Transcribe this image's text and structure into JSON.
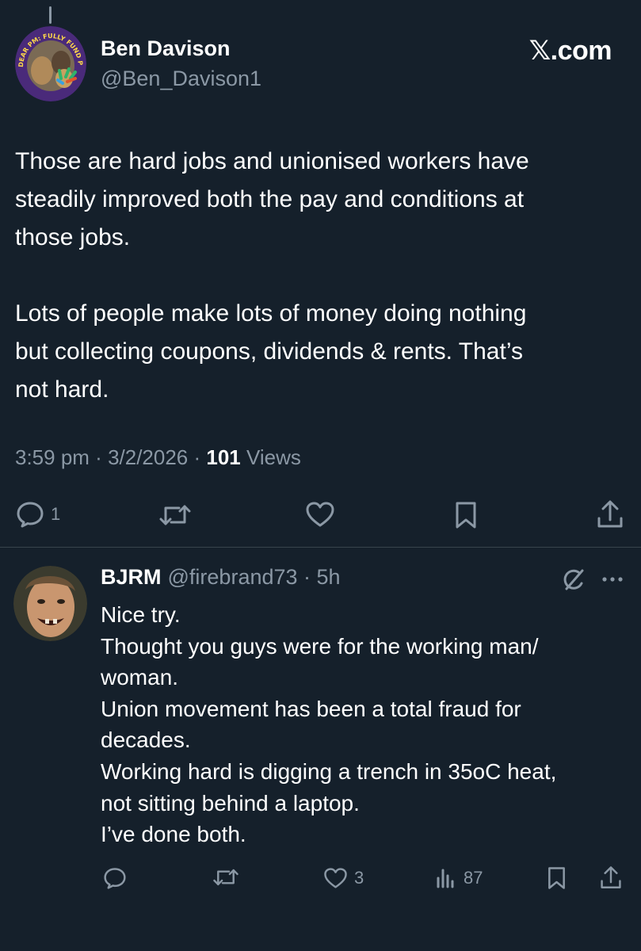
{
  "main_tweet": {
    "author": {
      "name": "Ben Davison",
      "handle": "@Ben_Davison1",
      "avatar_text": "DEAR PM: FULLY FUND PUBLIC SCHOOLS!"
    },
    "site_badge": "𝕏.com",
    "text_paragraphs": [
      "Those are hard jobs and unionised workers have\nsteadily improved both the pay and conditions at\nthose jobs.",
      "Lots of people make lots of money doing nothing\nbut collecting coupons, dividends & rents. That’s\nnot hard."
    ],
    "meta": {
      "time": "3:59 pm",
      "sep1": " · ",
      "date": "3/2/2026",
      "sep2": " · ",
      "views_count": "101",
      "views_label": " Views"
    },
    "actions": {
      "reply_count": "1",
      "icons": [
        "reply-icon",
        "retweet-icon",
        "like-icon",
        "bookmark-icon",
        "share-icon"
      ]
    }
  },
  "reply": {
    "author": {
      "name": "BJRM",
      "handle": "@firebrand73",
      "time": " · 5h"
    },
    "lines": [
      "Nice try.",
      "Thought you guys were for the working man/",
      "woman.",
      "Union movement has been a total fraud for",
      "decades.",
      "Working hard is digging a trench in 35oC heat,",
      "not sitting behind a laptop.",
      "I’ve done both."
    ],
    "actions": {
      "like_count": "3",
      "views_count": "87",
      "icons": [
        "reply-icon",
        "retweet-icon",
        "like-icon",
        "views-icon",
        "bookmark-icon",
        "share-icon"
      ]
    }
  },
  "colors": {
    "background": "#15202b",
    "text_primary": "#ffffff",
    "text_secondary": "#8b98a5",
    "divider": "#38444d"
  }
}
